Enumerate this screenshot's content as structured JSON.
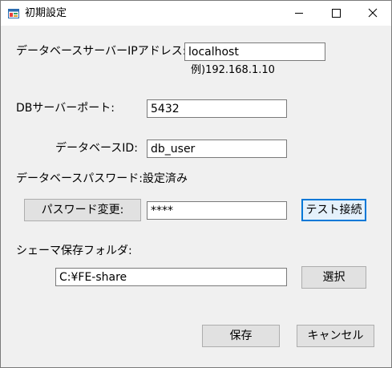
{
  "window": {
    "title": "初期設定"
  },
  "form": {
    "db_ip_label": "データベースサーバーIPアドレス:",
    "db_ip_value": "localhost",
    "db_ip_example": "例)192.168.1.10",
    "db_port_label": "DBサーバーポート:",
    "db_port_value": "5432",
    "db_id_label": "データベースID:",
    "db_id_value": "db_user",
    "password_status": "データベースパスワード:設定済み",
    "change_password_button": "パスワード変更:",
    "password_value": "****",
    "test_connection_button": "テスト接続",
    "schema_folder_label": "シェーマ保存フォルダ:",
    "schema_folder_value": "C:¥FE-share",
    "select_button": "選択"
  },
  "footer": {
    "save_button": "保存",
    "cancel_button": "キャンセル"
  },
  "icons": {
    "app": "app-window-icon",
    "minimize": "minimize-icon",
    "maximize": "maximize-icon",
    "close": "close-icon"
  },
  "colors": {
    "window_bg": "#f0f0f0",
    "focus_accent": "#0078d7"
  }
}
